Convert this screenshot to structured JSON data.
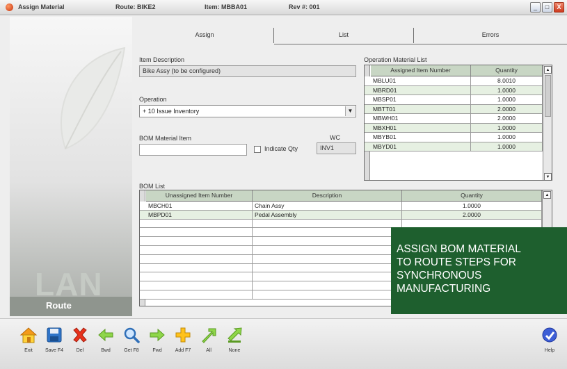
{
  "window": {
    "title": "Assign Material",
    "route": "Route: BIKE2",
    "item": "Item: MBBA01",
    "rev": "Rev #: 001",
    "buttons": {
      "minimize": "_",
      "maximize": "□",
      "close": "X"
    }
  },
  "left_panel": {
    "watermark": "LAN",
    "label": "Route"
  },
  "tabs": [
    {
      "label": "Assign",
      "active": true
    },
    {
      "label": "List",
      "active": false
    },
    {
      "label": "Errors",
      "active": false
    }
  ],
  "form": {
    "item_description_label": "Item Description",
    "item_description_value": "Bike Assy (to be configured)",
    "operation_label": "Operation",
    "operation_value": "+ 10 Issue Inventory",
    "bom_material_item_label": "BOM Material Item",
    "bom_material_item_value": "",
    "indicate_qty_label": "Indicate Qty",
    "indicate_qty_checked": false,
    "wc_label": "WC",
    "wc_value": "INV1"
  },
  "operation_material_list": {
    "title": "Operation Material List",
    "columns": [
      "Assigned Item Number",
      "Quantity"
    ],
    "rows": [
      [
        "MBLU01",
        "8.0010"
      ],
      [
        "MBRD01",
        "1.0000"
      ],
      [
        "MBSP01",
        "1.0000"
      ],
      [
        "MBTT01",
        "2.0000"
      ],
      [
        "MBWH01",
        "2.0000"
      ],
      [
        "MBXH01",
        "1.0000"
      ],
      [
        "MBYB01",
        "1.0000"
      ],
      [
        "MBYD01",
        "1.0000"
      ]
    ]
  },
  "bom_list": {
    "title": "BOM List",
    "columns": [
      "Unassigned Item Number",
      "Description",
      "Quantity"
    ],
    "rows": [
      [
        "MBCH01",
        "Chain Assy",
        "1.0000"
      ],
      [
        "MBPD01",
        "Pedal Assembly",
        "2.0000"
      ]
    ]
  },
  "overlay": {
    "lines": [
      "ASSIGN BOM MATERIAL",
      "TO ROUTE STEPS FOR",
      "SYNCHRONOUS",
      "MANUFACTURING"
    ]
  },
  "toolbar": [
    {
      "id": "exit",
      "label": "Exit",
      "icon": "home-icon"
    },
    {
      "id": "save",
      "label": "Save F4",
      "icon": "save-icon"
    },
    {
      "id": "del",
      "label": "Del",
      "icon": "delete-icon"
    },
    {
      "id": "bwd",
      "label": "Bwd",
      "icon": "arrow-left-icon"
    },
    {
      "id": "get",
      "label": "Get F8",
      "icon": "search-icon"
    },
    {
      "id": "fwd",
      "label": "Fwd",
      "icon": "arrow-right-icon"
    },
    {
      "id": "add",
      "label": "Add F7",
      "icon": "add-icon"
    },
    {
      "id": "all",
      "label": "All",
      "icon": "assign-all-icon"
    },
    {
      "id": "none",
      "label": "None",
      "icon": "assign-none-icon"
    }
  ],
  "help": {
    "label": "Help",
    "icon": "help-icon"
  },
  "colors": {
    "overlay_bg": "#1e5f2e",
    "grid_header": "#c8d6c4",
    "grid_alt_row": "#e6f0e2"
  }
}
